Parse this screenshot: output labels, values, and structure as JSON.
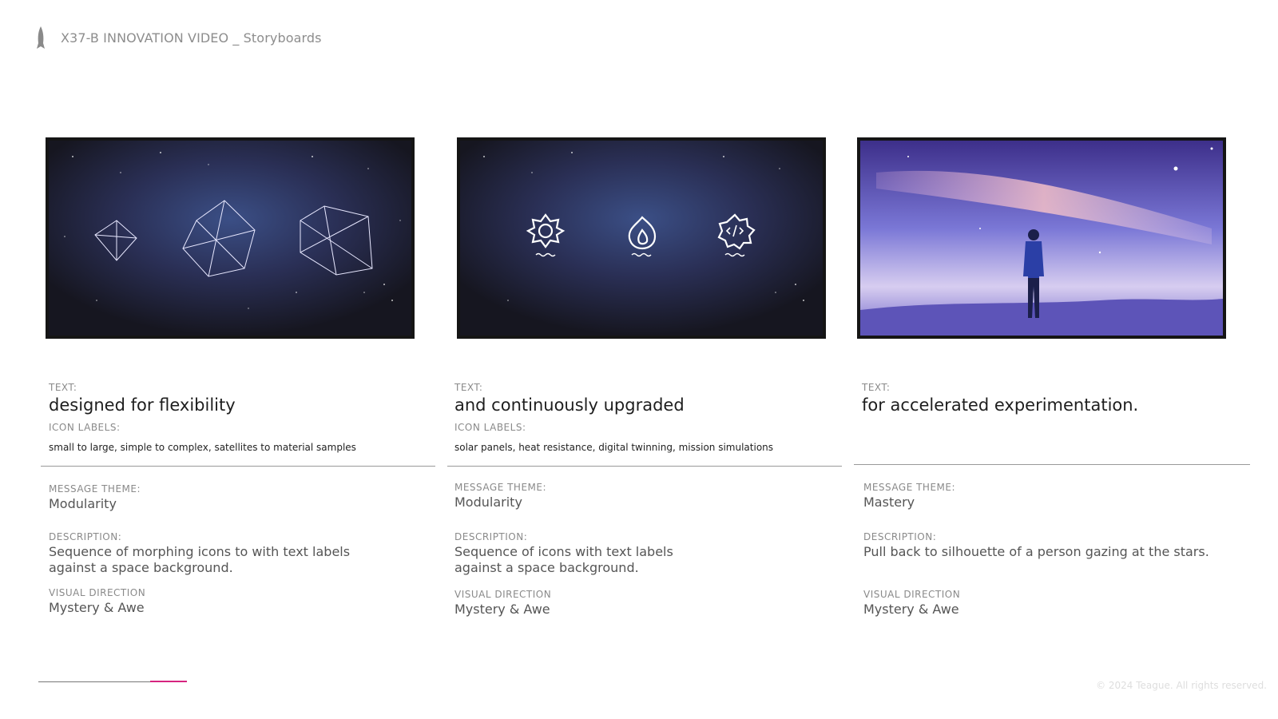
{
  "header": {
    "title": "X37-B INNOVATION VIDEO _ Storyboards"
  },
  "panels": [
    {
      "text_label": "TEXT:",
      "text": "designed for flexibility",
      "icon_labels_label": "ICON LABELS:",
      "icon_labels": "small to large,  simple to complex,  satellites to material samples",
      "theme_label": "MESSAGE THEME:",
      "theme": "Modularity",
      "description_label": "DESCRIPTION:",
      "description_line1": "Sequence of morphing icons to with text labels",
      "description_line2": "against a space background.",
      "visual_label": "VISUAL DIRECTION",
      "visual": "Mystery & Awe",
      "image": "space-polyhedra-sketch"
    },
    {
      "text_label": "TEXT:",
      "text": "and continuously upgraded",
      "icon_labels_label": "ICON LABELS:",
      "icon_labels": "solar panels, heat resistance, digital twinning, mission simulations",
      "theme_label": "MESSAGE THEME:",
      "theme": "Modularity",
      "description_label": "DESCRIPTION:",
      "description_line1": "Sequence of icons with text labels",
      "description_line2": "against a space background.",
      "visual_label": "VISUAL DIRECTION",
      "visual": "Mystery & Awe",
      "image": "space-icons-sketch",
      "icons": [
        "sun-icon",
        "flame-icon",
        "code-gear-icon"
      ]
    },
    {
      "text_label": "TEXT:",
      "text": "for accelerated experimentation.",
      "theme_label": "MESSAGE THEME:",
      "theme": "Mastery",
      "description_label": "DESCRIPTION:",
      "description_line1": "Pull back to silhouette of a person gazing at the stars.",
      "visual_label": "VISUAL DIRECTION",
      "visual": "Mystery & Awe",
      "image": "galaxy-person-sketch"
    }
  ],
  "footer": {
    "copyright": "© 2024 Teague. All rights reserved.",
    "accent_color": "#d6247f"
  }
}
